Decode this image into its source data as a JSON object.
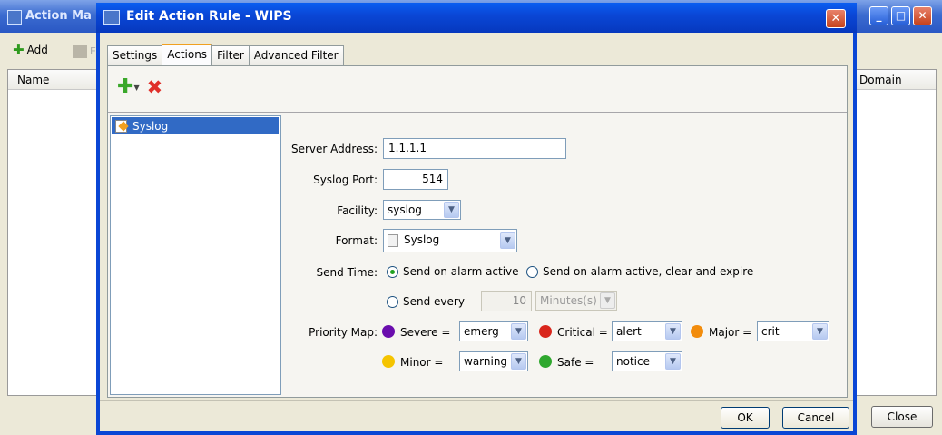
{
  "background_window": {
    "title": "Action Ma",
    "toolbar": {
      "add_label": "Add",
      "edit_label": "Ed"
    },
    "columns": [
      "Name",
      "Domain"
    ],
    "close_label": "Close"
  },
  "dialog": {
    "title": "Edit Action Rule - WIPS",
    "tabs": [
      {
        "label": "Settings"
      },
      {
        "label": "Actions"
      },
      {
        "label": "Filter"
      },
      {
        "label": "Advanced Filter"
      }
    ],
    "active_tab": "Actions",
    "action_list": [
      {
        "label": "Syslog",
        "selected": true
      }
    ],
    "form": {
      "server_address_label": "Server Address:",
      "server_address_value": "1.1.1.1",
      "syslog_port_label": "Syslog Port:",
      "syslog_port_value": "514",
      "facility_label": "Facility:",
      "facility_value": "syslog",
      "format_label": "Format:",
      "format_value": "Syslog",
      "send_time_label": "Send Time:",
      "send_time_options": [
        {
          "label": "Send on alarm active",
          "selected": true
        },
        {
          "label": "Send on alarm active, clear and expire",
          "selected": false
        },
        {
          "label": "Send every",
          "selected": false
        }
      ],
      "send_every_value": "10",
      "send_every_unit": "Minutes(s)",
      "priority_map_label": "Priority Map:",
      "priority_map": [
        {
          "severity": "Severe =",
          "value": "emerg",
          "color": "#6a0dad"
        },
        {
          "severity": "Critical =",
          "value": "alert",
          "color": "#d9261c"
        },
        {
          "severity": "Major =",
          "value": "crit",
          "color": "#f28c0c"
        },
        {
          "severity": "Minor =",
          "value": "warning",
          "color": "#f5c400"
        },
        {
          "severity": "Safe =",
          "value": "notice",
          "color": "#2fa82f"
        }
      ]
    },
    "ok_label": "OK",
    "cancel_label": "Cancel"
  }
}
